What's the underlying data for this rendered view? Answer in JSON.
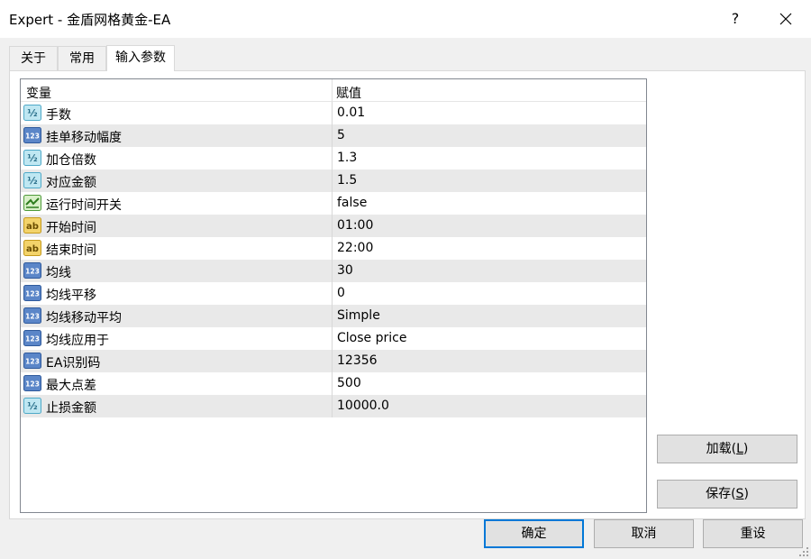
{
  "window": {
    "title": "Expert - 金盾网格黄金-EA",
    "help_label": "?"
  },
  "tabs": [
    {
      "label": "关于"
    },
    {
      "label": "常用"
    },
    {
      "label": "输入参数"
    }
  ],
  "grid": {
    "col_variable": "变量",
    "col_value": "赋值",
    "rows": [
      {
        "icon": "double-icon",
        "name": "手数",
        "value": "0.01"
      },
      {
        "icon": "integer-icon",
        "name": "挂单移动幅度",
        "value": "5"
      },
      {
        "icon": "double-icon",
        "name": "加仓倍数",
        "value": "1.3"
      },
      {
        "icon": "double-icon",
        "name": "对应金额",
        "value": "1.5"
      },
      {
        "icon": "bool-icon",
        "name": "运行时间开关",
        "value": "false"
      },
      {
        "icon": "string-icon",
        "name": "开始时间",
        "value": "01:00"
      },
      {
        "icon": "string-icon",
        "name": "结束时间",
        "value": "22:00"
      },
      {
        "icon": "integer-icon",
        "name": "均线",
        "value": "30"
      },
      {
        "icon": "integer-icon",
        "name": "均线平移",
        "value": "0"
      },
      {
        "icon": "integer-icon",
        "name": "均线移动平均",
        "value": "Simple"
      },
      {
        "icon": "integer-icon",
        "name": "均线应用于",
        "value": "Close price"
      },
      {
        "icon": "integer-icon",
        "name": "EA识别码",
        "value": "12356"
      },
      {
        "icon": "integer-icon",
        "name": "最大点差",
        "value": "500"
      },
      {
        "icon": "double-icon",
        "name": "止损金额",
        "value": "10000.0"
      }
    ]
  },
  "side_buttons": {
    "load_label": "加载(",
    "load_key": "L",
    "load_end": ")",
    "save_label": "保存(",
    "save_key": "S",
    "save_end": ")"
  },
  "bottom_buttons": {
    "ok": "确定",
    "cancel": "取消",
    "reset": "重设"
  },
  "icon_text": {
    "double": "½",
    "integer": "123",
    "string": "ab"
  },
  "colors": {
    "accent": "#0078d7",
    "row_alt": "#e9e9e9"
  }
}
